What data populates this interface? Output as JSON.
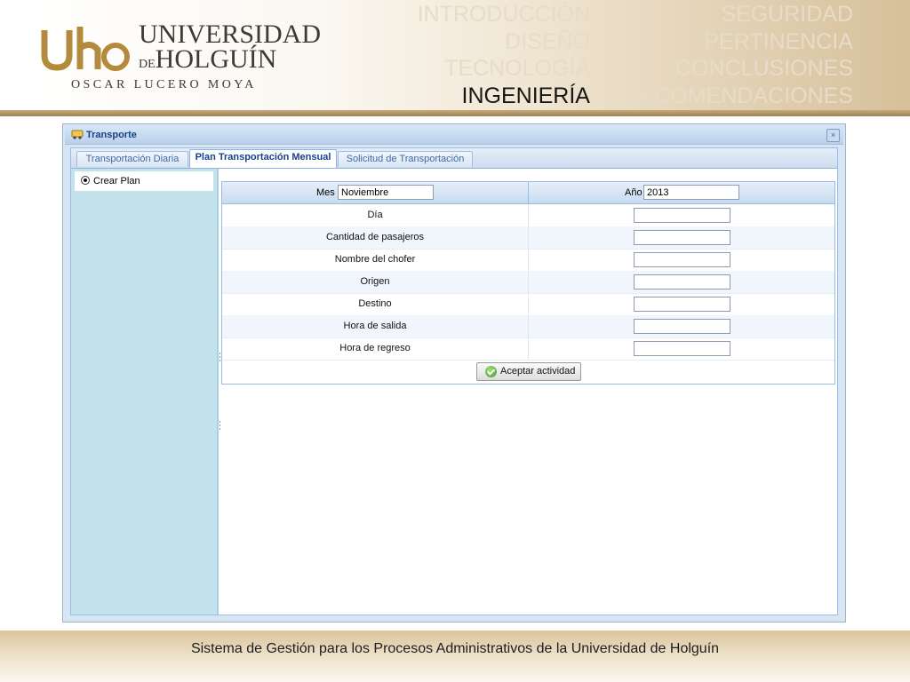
{
  "header": {
    "logo": {
      "line1": "UNIVERSIDAD",
      "de": "DE",
      "line2": "HOLGUÍN",
      "subtitle": "OSCAR LUCERO MOYA",
      "mark": "UHo"
    },
    "nav_left": [
      {
        "label": "INTRODUCCIÓN",
        "active": false
      },
      {
        "label": "DISEÑO",
        "active": false
      },
      {
        "label": "TECNOLOGÍA",
        "active": false
      },
      {
        "label": "INGENIERÍA",
        "active": true
      }
    ],
    "nav_right": [
      {
        "label": "SEGURIDAD",
        "active": false
      },
      {
        "label": "PERTINENCIA",
        "active": false
      },
      {
        "label": "CONCLUSIONES",
        "active": false
      },
      {
        "label": "RECOMENDACIONES",
        "active": false
      }
    ],
    "colors": {
      "active": "#161616",
      "inactive": "#e7dcc8",
      "band": "#c8aa79"
    }
  },
  "window": {
    "title": "Transporte",
    "icon": "transport-app-icon",
    "tabs": [
      {
        "label": "Transportación Diaria",
        "active": false
      },
      {
        "label": "Plan Transportación Mensual",
        "active": true
      },
      {
        "label": "Solicitud de Transportación",
        "active": false
      }
    ],
    "sidebar": {
      "items": [
        {
          "label": "Crear Plan",
          "selected": true
        }
      ]
    },
    "form": {
      "mes_label": "Mes",
      "mes_value": "Noviembre",
      "anio_label": "Año",
      "anio_value": "2013",
      "fields": [
        {
          "label": "Día",
          "value": ""
        },
        {
          "label": "Cantidad de pasajeros",
          "value": ""
        },
        {
          "label": "Nombre del chofer",
          "value": ""
        },
        {
          "label": "Origen",
          "value": ""
        },
        {
          "label": "Destino",
          "value": ""
        },
        {
          "label": "Hora de salida",
          "value": ""
        },
        {
          "label": "Hora de regreso",
          "value": ""
        }
      ],
      "submit_label": "Aceptar actividad",
      "submit_icon": "check-icon"
    }
  },
  "footer": {
    "text": "Sistema de Gestión para los Procesos Administrativos de la Universidad de Holguín"
  }
}
